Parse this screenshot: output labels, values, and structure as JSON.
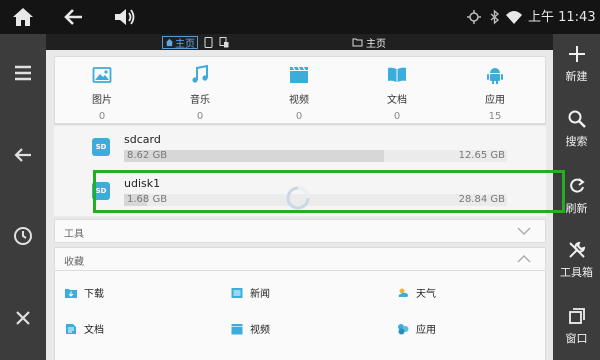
{
  "status_bar": {
    "time": "上午 11:43",
    "icons": [
      "home-icon",
      "back-arrow-icon",
      "volume-icon",
      "location-icon",
      "bluetooth-icon",
      "wifi-icon"
    ]
  },
  "tabs": {
    "active": {
      "label": "主页",
      "icon": "home-icon"
    },
    "other": {
      "label": "主页",
      "icon": "folder-icon"
    }
  },
  "left_toolbar": {
    "icons": [
      "menu-icon",
      "back-icon",
      "history-clock-icon",
      "close-icon"
    ]
  },
  "right_toolbar": {
    "new": "新建",
    "search": "搜索",
    "refresh": "刷新",
    "toolbox": "工具箱",
    "window": "窗口"
  },
  "categories": [
    {
      "label": "图片",
      "count": "0",
      "icon": "image-icon"
    },
    {
      "label": "音乐",
      "count": "0",
      "icon": "music-note-icon"
    },
    {
      "label": "视频",
      "count": "0",
      "icon": "video-icon"
    },
    {
      "label": "文档",
      "count": "0",
      "icon": "book-icon"
    },
    {
      "label": "应用",
      "count": "15",
      "icon": "android-icon"
    }
  ],
  "storage": [
    {
      "name": "sdcard",
      "badge": "SD",
      "used": "8.62 GB",
      "total": "12.65 GB",
      "used_fraction": 0.68
    },
    {
      "name": "udisk1",
      "badge": "SD",
      "used": "1.68 GB",
      "total": "28.84 GB",
      "used_fraction": 0.06
    }
  ],
  "sections": {
    "tools": "工具",
    "favorites": "收藏"
  },
  "favorites": [
    {
      "label": "下载",
      "icon": "download-folder-icon"
    },
    {
      "label": "新闻",
      "icon": "news-icon"
    },
    {
      "label": "天气",
      "icon": "weather-icon"
    },
    {
      "label": "文档",
      "icon": "document-icon"
    },
    {
      "label": "视频",
      "icon": "video-icon"
    },
    {
      "label": "应用",
      "icon": "app-icon"
    }
  ],
  "colors": {
    "accent_blue": "#3aaddb",
    "highlight_green": "#22b022",
    "toolbar_dark": "#3c3c3c"
  }
}
